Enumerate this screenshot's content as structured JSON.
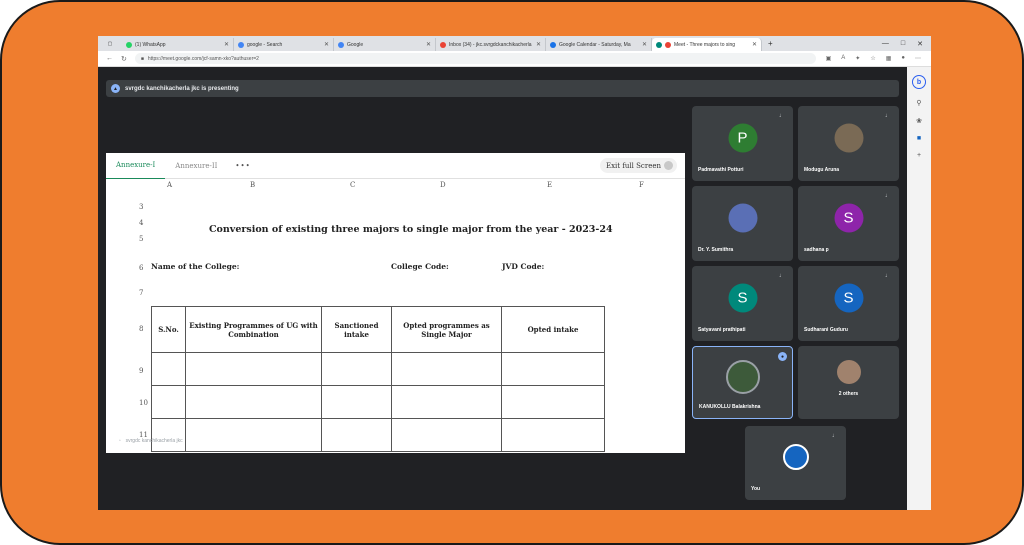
{
  "browser": {
    "tabs": [
      {
        "title": "(1) WhatsApp",
        "color": "#25d366"
      },
      {
        "title": "google - Search",
        "color": "#4285f4"
      },
      {
        "title": "Google",
        "color": "#4285f4"
      },
      {
        "title": "Inbox (34) - jkc.svrgdckanchikacherla",
        "color": "#ea4335"
      },
      {
        "title": "Google Calendar - Saturday, Ma",
        "color": "#1a73e8"
      },
      {
        "title": "Meet - Three majors to sing",
        "color": "#00897b"
      }
    ],
    "url": "https://meet.google.com/jcf-samn-xko?authuser=2"
  },
  "meet": {
    "presenting_text": "svrgdc kanchikacherla jkc is presenting",
    "presenter_overlay": "svrgdc kanchikacherla jkc"
  },
  "sheet": {
    "tabs": [
      "Annexure-I",
      "Annexure-II"
    ],
    "more": "•••",
    "exit_label": "Exit full Screen",
    "columns": [
      "A",
      "B",
      "C",
      "D",
      "E",
      "F"
    ],
    "rows": [
      "3",
      "4",
      "5",
      "6",
      "7",
      "8",
      "9",
      "10",
      "11"
    ],
    "title": "Conversion of existing three majors to single major from the year - 2023-24",
    "college_label": "Name of the College:",
    "code_label": "College Code:",
    "jvd_label": "JVD Code:",
    "table_headers": [
      "S.No.",
      "Existing Programmes of UG with Combination",
      "Sanctioned intake",
      "Opted programmes as Single Major",
      "Opted intake"
    ]
  },
  "participants": [
    {
      "name": "Padmavathi Potturi",
      "initial": "P",
      "color": "#2e7d32"
    },
    {
      "name": "Modugu Aruna",
      "initial": "",
      "color": "#7a6a55"
    },
    {
      "name": "Dr. Y. Sumithra",
      "initial": "",
      "color": "#5a6fb5"
    },
    {
      "name": "sadhana p",
      "initial": "S",
      "color": "#8e24aa"
    },
    {
      "name": "Satyavani prathipati",
      "initial": "S",
      "color": "#00897b"
    },
    {
      "name": "Sudharani Guduru",
      "initial": "S",
      "color": "#1565c0"
    },
    {
      "name": "KANUKOLLU Balakrishna",
      "initial": "",
      "color": "#3d5a3a"
    },
    {
      "name": "2 others",
      "initial": "",
      "color": "#a0826d"
    },
    {
      "name": "You",
      "initial": "",
      "color": "#1565c0"
    }
  ]
}
